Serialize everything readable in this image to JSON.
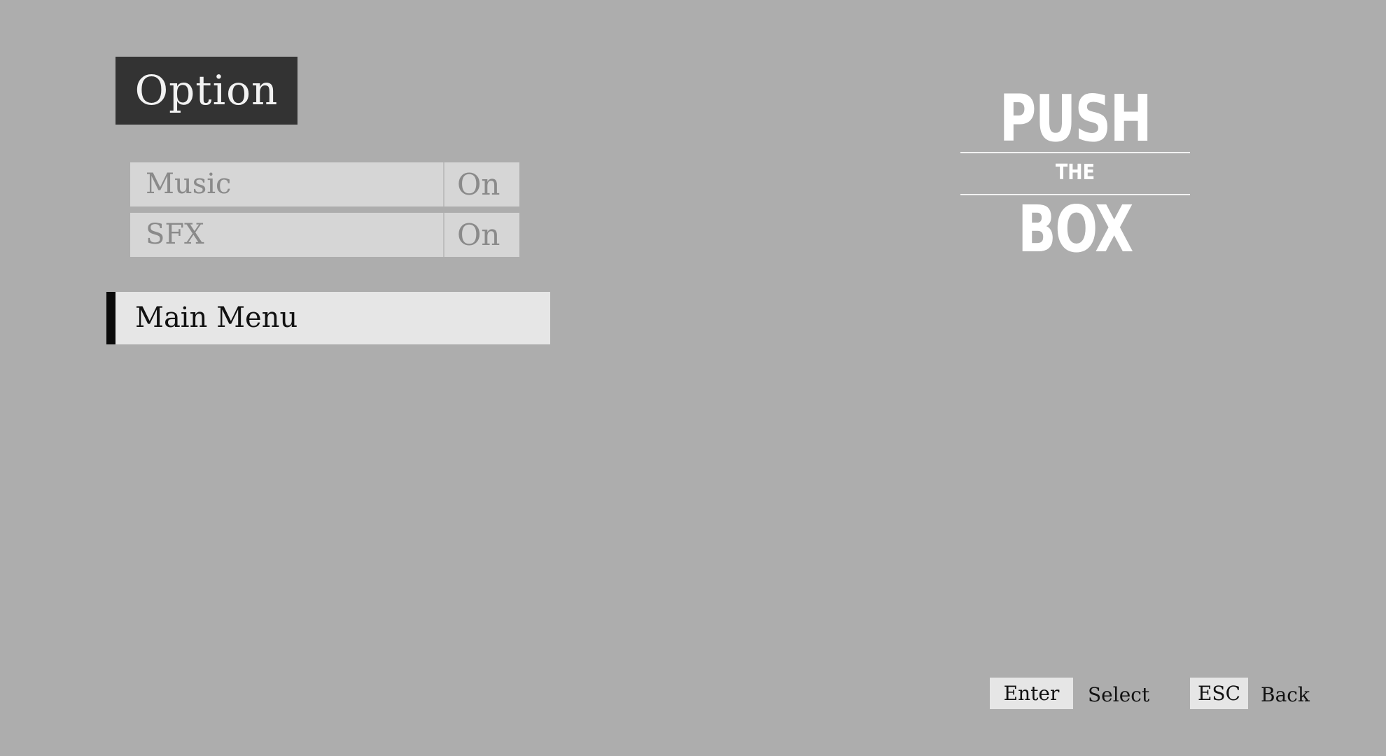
{
  "screen": {
    "title": "Option"
  },
  "options": [
    {
      "label": "Music",
      "value": "On"
    },
    {
      "label": "SFX",
      "value": "On"
    }
  ],
  "menu": {
    "main_menu_label": "Main Menu"
  },
  "logo": {
    "line1": "PUSH",
    "line2": "THE",
    "line3": "BOX"
  },
  "controls": {
    "select_key": "Enter",
    "select_action": "Select",
    "back_key": "ESC",
    "back_action": "Back"
  },
  "colors": {
    "background": "#adadad",
    "title_bg": "#333333",
    "highlight": "#e6e6e6",
    "selection_bar": "#0a0a0a"
  }
}
